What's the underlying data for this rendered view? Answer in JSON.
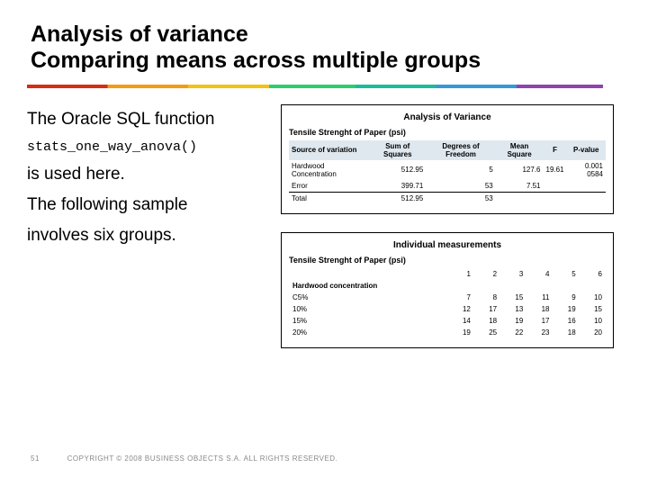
{
  "title_line1": "Analysis of variance",
  "title_line2": "Comparing means across multiple groups",
  "body": {
    "l1": "The Oracle SQL function",
    "code": "stats_one_way_anova()",
    "l2": "is used here.",
    "l3": "The following sample",
    "l4": "involves six groups."
  },
  "panel1": {
    "title": "Analysis of Variance",
    "subhead": "Tensile Strenght of Paper (psi)",
    "headers": [
      "Source of variation",
      "Sum of Squares",
      "Degrees of Freedom",
      "Mean Square",
      "F",
      "P-value"
    ],
    "rows": [
      [
        "Hardwood Concentration",
        "512.95",
        "5",
        "127.6",
        "19.61",
        "0.001 0584"
      ],
      [
        "Error",
        "399.71",
        "53",
        "7.51",
        "",
        ""
      ],
      [
        "Total",
        "512.95",
        "53",
        "",
        "",
        ""
      ]
    ]
  },
  "panel2": {
    "title": "Individual measurements",
    "subhead": "Tensile Strenght of Paper (psi)",
    "col_headers": [
      "1",
      "2",
      "3",
      "4",
      "5",
      "6"
    ],
    "rows": [
      [
        "Hardwood concentration",
        "",
        "",
        "",
        "",
        "",
        ""
      ],
      [
        "C5%",
        "7",
        "8",
        "15",
        "11",
        "9",
        "10"
      ],
      [
        "10%",
        "12",
        "17",
        "13",
        "18",
        "19",
        "15"
      ],
      [
        "15%",
        "14",
        "18",
        "19",
        "17",
        "16",
        "10"
      ],
      [
        "20%",
        "19",
        "25",
        "22",
        "23",
        "18",
        "20"
      ]
    ]
  },
  "footer": {
    "page": "51",
    "copyright": "COPYRIGHT © 2008 BUSINESS OBJECTS S.A.  ALL RIGHTS RESERVED."
  }
}
